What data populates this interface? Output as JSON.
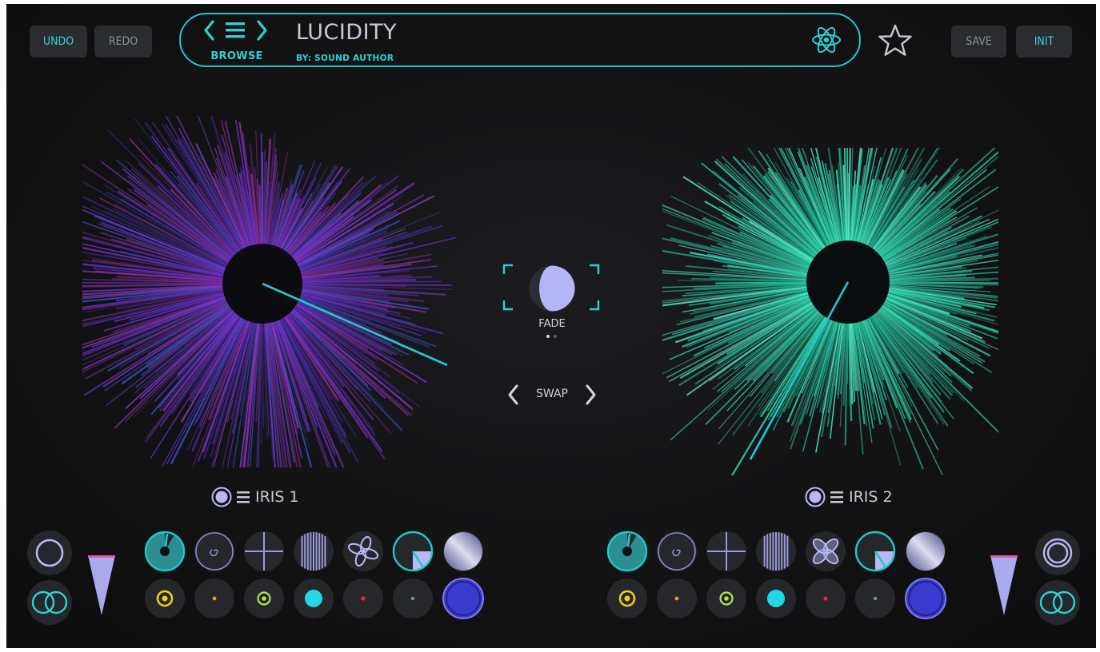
{
  "toolbar": {
    "undo_label": "UNDO",
    "redo_label": "REDO",
    "save_label": "SAVE",
    "init_label": "INIT"
  },
  "header": {
    "browse_label": "BROWSE",
    "preset_name": "LUCIDITY",
    "author": "BY: SOUND AUTHOR",
    "engine_icon": "atom-icon",
    "favorite_icon": "star-outline-icon"
  },
  "center": {
    "mix_mode_label": "FADE",
    "swap_label": "SWAP",
    "page_dots": 2,
    "active_page": 1
  },
  "iris1": {
    "label": "IRIS 1",
    "accent": "#7a3fe0"
  },
  "iris2": {
    "label": "IRIS 2",
    "accent": "#2ee3b8"
  },
  "colors": {
    "accent": "#1fc9cb",
    "background": "#121213",
    "button_bg": "#2a2c2f",
    "lavender": "#b9b8f5",
    "indigo": "#3a3ad0"
  },
  "icons": {
    "shape_row": [
      "pie-sector-icon",
      "spiral-icon",
      "crosshair-icon",
      "vertical-lines-icon",
      "flower-icon",
      "quarter-sector-icon",
      "gradient-disc-icon"
    ],
    "color_row": [
      "yellow-ring-dot-icon",
      "orange-dot-icon",
      "green-ring-dot-icon",
      "cyan-dot-icon",
      "red-dot-icon",
      "grey-dot-icon",
      "blue-disc-icon"
    ]
  }
}
